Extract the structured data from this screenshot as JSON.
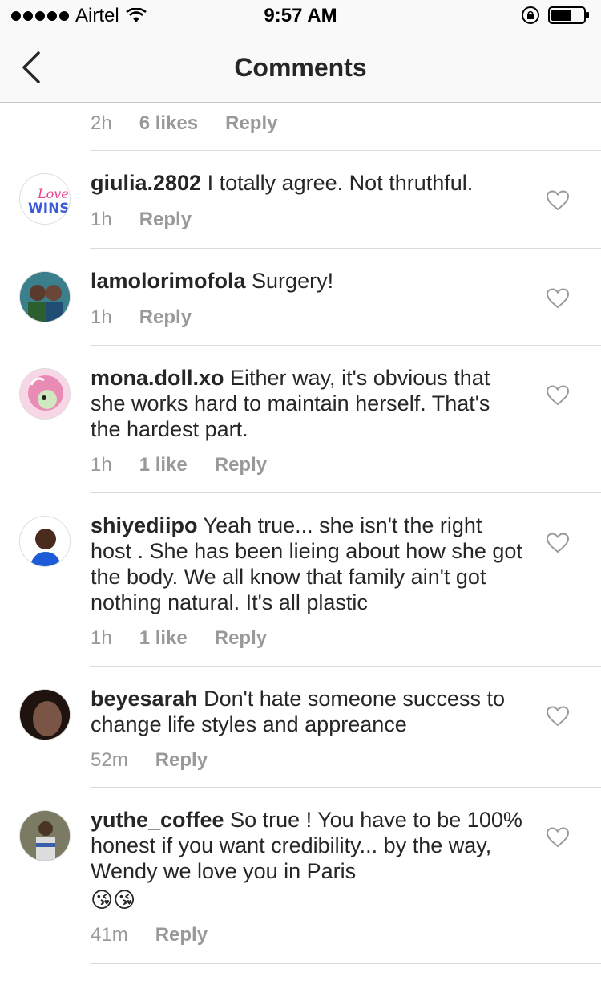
{
  "status_bar": {
    "carrier": "Airtel",
    "time": "9:57 AM"
  },
  "nav": {
    "title": "Comments"
  },
  "partial_comment": {
    "time": "2h",
    "likes": "6 likes",
    "reply": "Reply"
  },
  "comments": [
    {
      "username": "giulia.2802",
      "text": " I totally agree. Not thruthful.",
      "time": "1h",
      "likes": "",
      "reply": "Reply",
      "avatar_text_1": "Love",
      "avatar_text_2": "WINS"
    },
    {
      "username": "lamolorimofola",
      "text": " Surgery!",
      "time": "1h",
      "likes": "",
      "reply": "Reply"
    },
    {
      "username": "mona.doll.xo",
      "text": " Either way, it's obvious that she works hard to maintain herself. That's the hardest part.",
      "time": "1h",
      "likes": "1 like",
      "reply": "Reply"
    },
    {
      "username": "shiyediipo",
      "text": " Yeah true... she isn't the right host .  She has been lieing about how she got the body. We all know that family ain't got nothing natural.  It's all plastic",
      "time": "1h",
      "likes": "1 like",
      "reply": "Reply"
    },
    {
      "username": "beyesarah",
      "text": " Don't hate someone success to change life styles and appreance",
      "time": "52m",
      "likes": "",
      "reply": "Reply"
    },
    {
      "username": "yuthe_coffee",
      "text": " So true ! You have to be 100% honest if you want credibility... by the way, Wendy we love you in Paris",
      "emojis": "😘😘",
      "time": "41m",
      "likes": "",
      "reply": "Reply"
    }
  ],
  "colors": {
    "text": "#262626",
    "meta": "#999999",
    "divider": "#dbdbdb",
    "bar_bg": "#f9f9f9"
  }
}
